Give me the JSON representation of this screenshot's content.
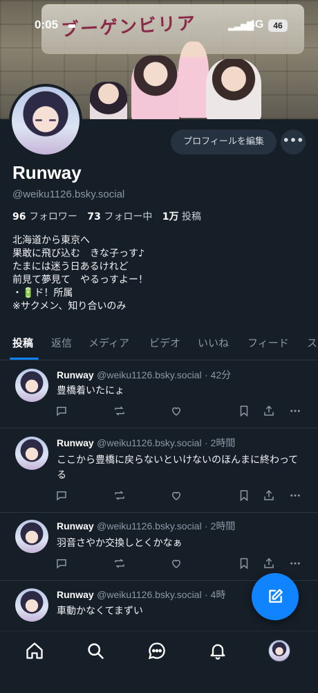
{
  "status_bar": {
    "time": "0:05",
    "network": "4G",
    "battery": "46"
  },
  "banner": {
    "sign_text": "ブーゲンビリア"
  },
  "profile": {
    "display_name": "Runway",
    "handle": "@weiku1126.bsky.social",
    "edit_button_label": "プロフィールを編集",
    "more_label": "•••",
    "stats": {
      "followers_count": "96",
      "followers_label": "フォロワー",
      "following_count": "73",
      "following_label": "フォロー中",
      "posts_count": "1万",
      "posts_label": "投稿"
    },
    "bio_lines": [
      "北海道から東京へ",
      "果敢に飛び込む　きな子っす♪",
      "たまには迷う日あるけれど",
      "前見て夢見て　やるっすよー！",
      "・🔋ド！所属",
      "※サクメン、知り合いのみ"
    ]
  },
  "tabs": [
    {
      "label": "投稿",
      "active": true
    },
    {
      "label": "返信",
      "active": false
    },
    {
      "label": "メディア",
      "active": false
    },
    {
      "label": "ビデオ",
      "active": false
    },
    {
      "label": "いいね",
      "active": false
    },
    {
      "label": "フィード",
      "active": false
    },
    {
      "label": "ス",
      "active": false
    }
  ],
  "posts": [
    {
      "name": "Runway",
      "handle": "@weiku1126.bsky.social",
      "time": "· 42分",
      "text": "豊橋着いたにょ"
    },
    {
      "name": "Runway",
      "handle": "@weiku1126.bsky.social",
      "time": "· 2時間",
      "text": "ここから豊橋に戻らないといけないのほんまに終わってる"
    },
    {
      "name": "Runway",
      "handle": "@weiku1126.bsky.social",
      "time": "· 2時間",
      "text": "羽音さやか交換しとくかなぁ"
    },
    {
      "name": "Runway",
      "handle": "@weiku1126.bsky.social",
      "time": "· 4時",
      "text": "車動かなくてまずい"
    }
  ],
  "icons": {
    "reply": "reply-icon",
    "repost": "repost-icon",
    "like": "heart-icon",
    "bookmark": "bookmark-icon",
    "share": "share-icon",
    "more": "more-icon",
    "compose": "compose-icon",
    "home": "home-icon",
    "search": "search-icon",
    "chat": "chat-icon",
    "notifications": "bell-icon"
  },
  "colors": {
    "background": "#161e27",
    "accent": "#1083fe",
    "muted_text": "#8c98a6",
    "button_bg": "#263240"
  }
}
